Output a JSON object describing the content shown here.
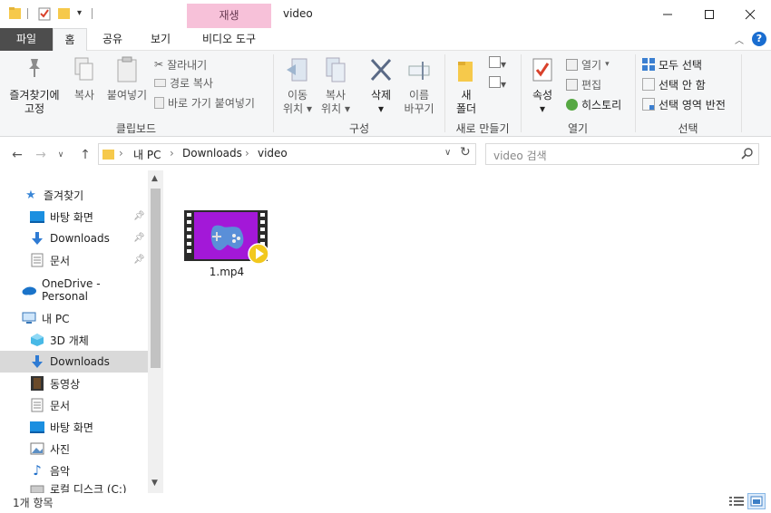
{
  "titlebar": {
    "context_tab": "재생",
    "title": "video"
  },
  "tabs": {
    "file": "파일",
    "home": "홈",
    "share": "공유",
    "view": "보기",
    "video_tools": "비디오 도구"
  },
  "ribbon": {
    "clipboard": {
      "pin_quick_1": "즐겨찾기에",
      "pin_quick_2": "고정",
      "copy": "복사",
      "paste": "붙여넣기",
      "cut": "잘라내기",
      "copy_path": "경로 복사",
      "paste_shortcut": "바로 가기 붙여넣기",
      "group": "클립보드"
    },
    "organize": {
      "move_1": "이동",
      "move_2": "위치",
      "copy_1": "복사",
      "copy_2": "위치",
      "delete": "삭제",
      "rename_1": "이름",
      "rename_2": "바꾸기",
      "group": "구성"
    },
    "new": {
      "new_folder_1": "새",
      "new_folder_2": "폴더",
      "group": "새로 만들기"
    },
    "open": {
      "properties": "속성",
      "open": "열기",
      "edit": "편집",
      "history": "히스토리",
      "group": "열기"
    },
    "select": {
      "select_all": "모두 선택",
      "select_none": "선택 안 함",
      "invert": "선택 영역 반전",
      "group": "선택"
    }
  },
  "address": {
    "crumbs": [
      "내 PC",
      "Downloads",
      "video"
    ],
    "search_placeholder": "video 검색"
  },
  "nav": {
    "quick_access": "즐겨찾기",
    "desktop": "바탕 화면",
    "downloads": "Downloads",
    "documents": "문서",
    "onedrive": "OneDrive - Personal",
    "this_pc": "내 PC",
    "objects3d": "3D 개체",
    "downloads2": "Downloads",
    "videos": "동영상",
    "documents2": "문서",
    "desktop2": "바탕 화면",
    "pictures": "사진",
    "music": "음악",
    "local_disk": "로컬 디스크 (C:)"
  },
  "files": [
    {
      "name": "1.mp4"
    }
  ],
  "status": {
    "count": "1개 항목"
  }
}
